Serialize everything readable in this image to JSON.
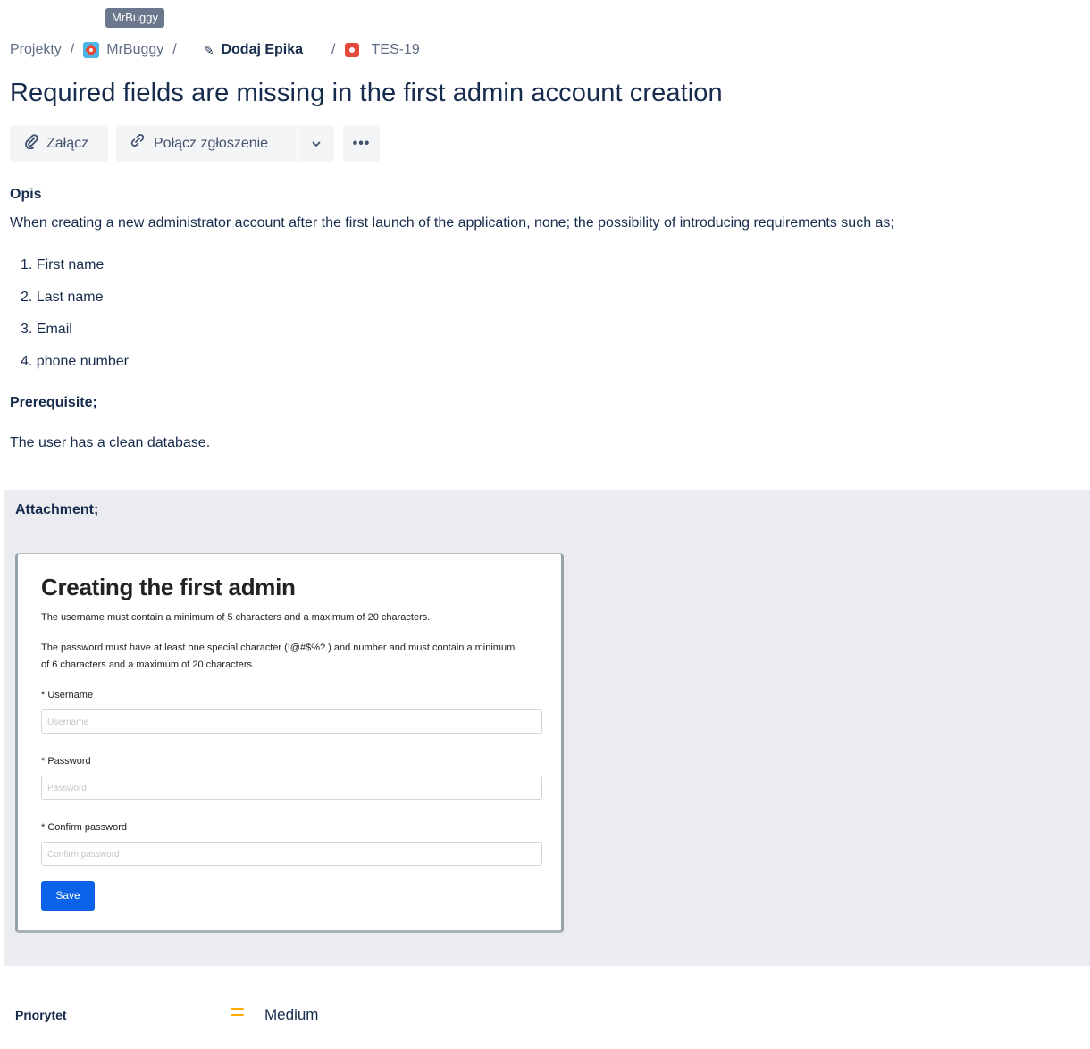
{
  "tooltip": "MrBuggy",
  "breadcrumb": {
    "projects": "Projekty",
    "sep1": "/",
    "project": "MrBuggy",
    "sep2": "/",
    "epic": "Dodaj Epika",
    "sep3": "/",
    "issue_key": "TES-19"
  },
  "issue": {
    "title": "Required fields are missing in the first admin account creation"
  },
  "toolbar": {
    "attach_label": "Załącz",
    "link_label": "Połącz zgłoszenie",
    "more_label": "•••"
  },
  "description": {
    "heading": "Opis",
    "text": "When creating a new administrator account after the first launch of the application, none; the possibility of introducing requirements such as;",
    "items": [
      "1. First name",
      "2. Last name",
      "3. Email",
      "4. phone number"
    ],
    "prereq_heading": "Prerequisite;",
    "prereq_text": "The user has a clean database.",
    "attachment_heading": "Attachment;"
  },
  "attachment_image": {
    "heading": "Creating the first admin",
    "rule_username": "The username must contain a minimum of 5 characters and a maximum of 20 characters.",
    "rule_password": "The password must have at least one special character (!@#$%?.) and number and must contain a minimum of 6 characters and a maximum of 20 characters.",
    "username_label": "* Username",
    "username_placeholder": "Username",
    "password_label": "* Password",
    "password_placeholder": "Password",
    "confirm_label": "* Confirm password",
    "confirm_placeholder": "Confirm password",
    "save_label": "Save"
  },
  "fields": {
    "priority_label": "Priorytet",
    "priority_value": "Medium",
    "priority_color": "#ffab00"
  }
}
